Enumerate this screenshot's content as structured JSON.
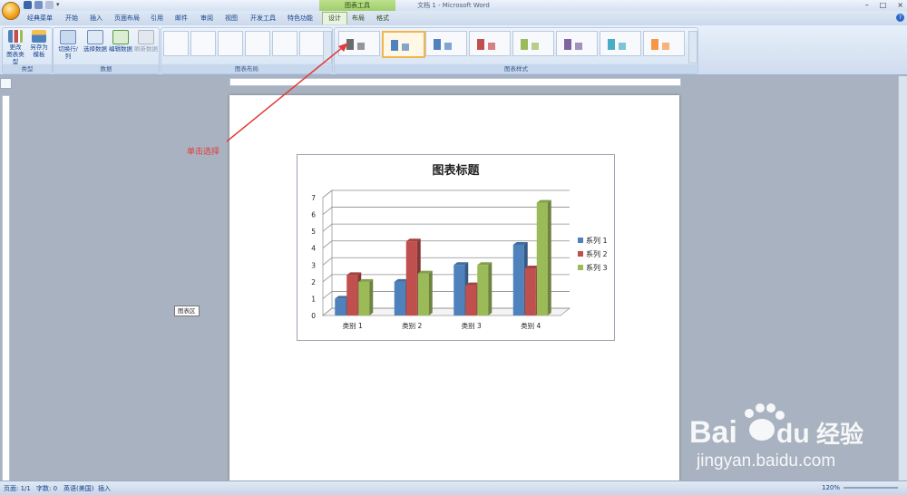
{
  "app": {
    "doc_title": "文档 1 - Microsoft Word",
    "context_tab_group": "图表工具",
    "window_controls": [
      "–",
      "□",
      "×"
    ]
  },
  "tabs": [
    {
      "label": "经典菜单",
      "active": false
    },
    {
      "label": "开始",
      "active": false
    },
    {
      "label": "插入",
      "active": false
    },
    {
      "label": "页面布局",
      "active": false
    },
    {
      "label": "引用",
      "active": false
    },
    {
      "label": "邮件",
      "active": false
    },
    {
      "label": "审阅",
      "active": false
    },
    {
      "label": "视图",
      "active": false
    },
    {
      "label": "开发工具",
      "active": false
    },
    {
      "label": "特色功能",
      "active": false
    },
    {
      "label": "设计",
      "active": true,
      "context": true
    },
    {
      "label": "布局",
      "active": false,
      "context": true
    },
    {
      "label": "格式",
      "active": false,
      "context": true
    }
  ],
  "ribbon": {
    "groups": {
      "type": "类型",
      "data": "数据",
      "layouts": "图表布局",
      "styles": "图表样式"
    },
    "buttons": {
      "change_type": "更改\n图表类型",
      "save_template": "另存为\n模板",
      "switch_rowcol": "切换行/列",
      "select_data": "选择数据",
      "edit_data": "编辑数据",
      "refresh_data": "刷新数据"
    },
    "style_palette": [
      "#6b6b6b",
      "#4f81bd",
      "#4f81bd",
      "#c0504d",
      "#9bbb59",
      "#8064a2",
      "#4bacc6",
      "#f79646"
    ],
    "selected_style_index": 1
  },
  "annotation": {
    "text": "单击选择",
    "color": "#e23b3b"
  },
  "tooltip": {
    "text": "图表区"
  },
  "chart_data": {
    "type": "bar",
    "title": "图表标题",
    "categories": [
      "类别 1",
      "类别 2",
      "类别 3",
      "类别 4"
    ],
    "series": [
      {
        "name": "系列 1",
        "values": [
          1,
          2,
          3,
          4.2
        ],
        "color": "#4f81bd"
      },
      {
        "name": "系列 2",
        "values": [
          2.4,
          4.4,
          1.8,
          2.8
        ],
        "color": "#c0504d"
      },
      {
        "name": "系列 3",
        "values": [
          2,
          2.5,
          3,
          6.7
        ],
        "color": "#9bbb59"
      }
    ],
    "ylim": [
      0,
      7
    ],
    "yticks": [
      "0",
      "1",
      "2",
      "3",
      "4",
      "5",
      "6",
      "7"
    ],
    "grid": true,
    "legend": "right",
    "style": "3D clustered column"
  },
  "status": {
    "page": "页面: 1/1",
    "words": "字数: 0",
    "language": "英语(美国)",
    "mode": "插入",
    "zoom": "120%"
  },
  "watermark": {
    "brand": "Baidu",
    "brand_cn": "经验",
    "url": "jingyan.baidu.com"
  }
}
